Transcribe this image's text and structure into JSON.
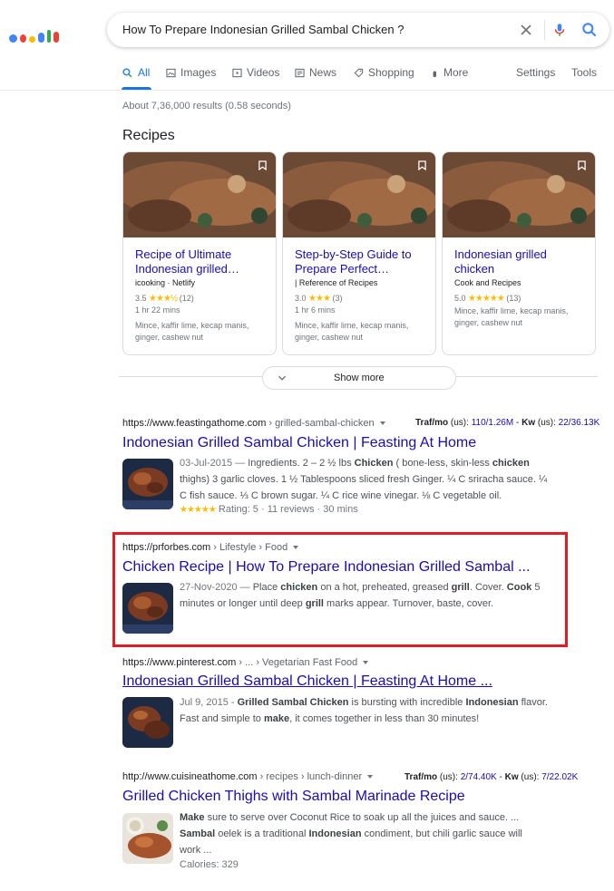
{
  "search": {
    "query": "How To Prepare Indonesian Grilled Sambal Chicken ?"
  },
  "tabs": [
    {
      "label": "All",
      "icon": "search-icon",
      "active": true
    },
    {
      "label": "Images",
      "icon": "image-icon"
    },
    {
      "label": "Videos",
      "icon": "video-icon"
    },
    {
      "label": "News",
      "icon": "news-icon"
    },
    {
      "label": "Shopping",
      "icon": "tag-icon"
    },
    {
      "label": "More",
      "icon": "more-dots-icon"
    }
  ],
  "tools": {
    "settings": "Settings",
    "tools": "Tools"
  },
  "stats": "About 7,36,000 results (0.58 seconds)",
  "recipes": {
    "title": "Recipes",
    "cards": [
      {
        "title": "Recipe of Ultimate Indonesian grilled…",
        "source": "icooking · Netlify",
        "rating": "3.5",
        "stars": "★★★½",
        "reviews": "(12)",
        "time": "1 hr 22 mins",
        "ingredients": "Mince, kaffir lime, kecap manis, ginger, cashew nut"
      },
      {
        "title": "Step-by-Step Guide to Prepare Perfect…",
        "source": "| Reference of Recipes",
        "rating": "3.0",
        "stars": "★★★",
        "reviews": "(3)",
        "time": "1 hr 6 mins",
        "ingredients": "Mince, kaffir lime, kecap manis, ginger, cashew nut"
      },
      {
        "title": "Indonesian grilled chicken",
        "source": "Cook and Recipes",
        "rating": "5.0",
        "stars": "★★★★★",
        "reviews": "(13)",
        "time": "",
        "ingredients": "Mince, kaffir lime, kecap manis, ginger, cashew nut"
      }
    ],
    "show_more": "Show more"
  },
  "results": [
    {
      "url": "https://www.feastingathome.com",
      "crumbs": " › grilled-sambal-chicken",
      "traffic": {
        "label1": "Traf/mo",
        "unit": "(us):",
        "v1": "110/1.26M",
        "sep": "-",
        "label2": "Kw",
        "v2": "22/36.13K"
      },
      "title": "Indonesian Grilled Sambal Chicken | Feasting At Home",
      "snippet": [
        {
          "t": "03-Jul-2015 — ",
          "c": "date"
        },
        {
          "t": "Ingredients. 2 – 2 ½ lbs "
        },
        {
          "t": "Chicken",
          "b": true
        },
        {
          "t": " ( bone-less, skin-less "
        },
        {
          "t": "chicken",
          "b": true
        },
        {
          "t": " thighs) 3 garlic cloves. 1 ½ Tablespoons sliced fresh Ginger. ¼ C sriracha sauce. ¼ C fish sauce. ⅓ C brown sugar. ¼ C rice wine vinegar. ⅛ C vegetable oil."
        }
      ],
      "rating": {
        "stars": "★★★★★",
        "text": "Rating: 5 · 11 reviews · 30 mins"
      }
    },
    {
      "url": "https://prforbes.com",
      "crumbs": " › Lifestyle › Food",
      "title": "Chicken Recipe | How To Prepare Indonesian Grilled Sambal ...",
      "snippet": [
        {
          "t": "27-Nov-2020 — ",
          "c": "date"
        },
        {
          "t": "Place "
        },
        {
          "t": "chicken",
          "b": true
        },
        {
          "t": " on a hot, preheated, greased "
        },
        {
          "t": "grill",
          "b": true
        },
        {
          "t": ". Cover. "
        },
        {
          "t": "Cook",
          "b": true
        },
        {
          "t": " 5 minutes or longer until deep "
        },
        {
          "t": "grill",
          "b": true
        },
        {
          "t": " marks appear. Turnover, baste, cover."
        }
      ]
    },
    {
      "url": "https://www.pinterest.com",
      "crumbs": " › ... › Vegetarian Fast Food",
      "title": "Indonesian Grilled Sambal Chicken | Feasting At Home ...",
      "snippet": [
        {
          "t": "Jul 9, 2015 - ",
          "c": "date"
        },
        {
          "t": "Grilled Sambal Chicken",
          "b": true
        },
        {
          "t": " is bursting with incredible "
        },
        {
          "t": "Indonesian",
          "b": true
        },
        {
          "t": " flavor. Fast and simple to "
        },
        {
          "t": "make",
          "b": true
        },
        {
          "t": ", it comes together in less than 30 minutes!"
        }
      ]
    },
    {
      "url": "http://www.cuisineathome.com",
      "crumbs": " › recipes › lunch-dinner",
      "traffic": {
        "label1": "Traf/mo",
        "unit": "(us):",
        "v1": "2/74.40K",
        "sep": "-",
        "label2": "Kw",
        "v2": "7/22.02K"
      },
      "title": "Grilled Chicken Thighs with Sambal Marinade Recipe",
      "snippet": [
        {
          "t": "Make",
          "b": true
        },
        {
          "t": " sure to serve over Coconut Rice to soak up all the juices and sauce. ... "
        },
        {
          "t": "Sambal",
          "b": true
        },
        {
          "t": " oelek is a traditional "
        },
        {
          "t": "Indonesian",
          "b": true
        },
        {
          "t": " condiment, but chili garlic sauce will work ..."
        }
      ],
      "extra": "Calories: 329"
    }
  ],
  "colors": {
    "link": "#1a0dab",
    "accent": "#1a73e8",
    "highlight_box": "#e21b24",
    "star": "#fbbc04"
  }
}
